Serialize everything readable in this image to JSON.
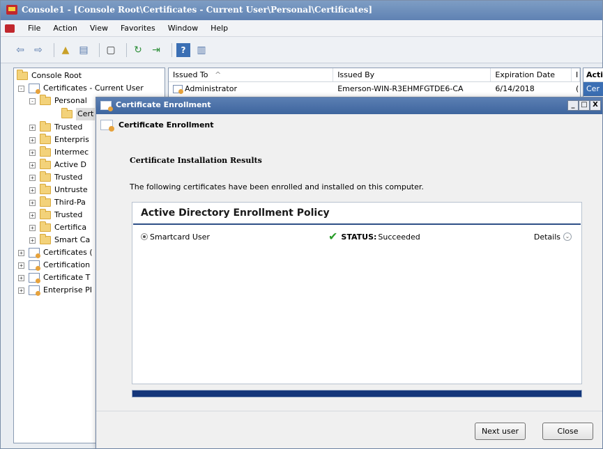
{
  "window": {
    "title": "Console1 - [Console Root\\Certificates - Current User\\Personal\\Certificates]"
  },
  "menubar": [
    "File",
    "Action",
    "View",
    "Favorites",
    "Window",
    "Help"
  ],
  "toolbar": {
    "icons": [
      "back-arrow-icon",
      "forward-arrow-icon",
      "up-folder-icon",
      "show-hide-tree-icon",
      "properties-icon",
      "refresh-icon",
      "export-list-icon",
      "help-icon",
      "show-hide-action-pane-icon"
    ]
  },
  "tree": {
    "items": [
      {
        "label": "Console Root",
        "icon": "folder-icon",
        "expander": ""
      },
      {
        "label": "Certificates - Current User",
        "icon": "certificate-store-icon",
        "expander": "-"
      },
      {
        "label": "Personal",
        "icon": "folder-icon",
        "expander": "-"
      },
      {
        "label": "Cert",
        "icon": "folder-icon",
        "expander": ""
      },
      {
        "label": "Trusted",
        "icon": "folder-icon",
        "expander": "+"
      },
      {
        "label": "Enterpris",
        "icon": "folder-icon",
        "expander": "+"
      },
      {
        "label": "Intermec",
        "icon": "folder-icon",
        "expander": "+"
      },
      {
        "label": "Active D",
        "icon": "folder-icon",
        "expander": "+"
      },
      {
        "label": "Trusted",
        "icon": "folder-icon",
        "expander": "+"
      },
      {
        "label": "Untruste",
        "icon": "folder-icon",
        "expander": "+"
      },
      {
        "label": "Third-Pa",
        "icon": "folder-icon",
        "expander": "+"
      },
      {
        "label": "Trusted",
        "icon": "folder-icon",
        "expander": "+"
      },
      {
        "label": "Certifica",
        "icon": "folder-icon",
        "expander": "+"
      },
      {
        "label": "Smart Ca",
        "icon": "folder-icon",
        "expander": "+"
      },
      {
        "label": "Certificates (",
        "icon": "certificate-store-icon",
        "expander": "+"
      },
      {
        "label": "Certification",
        "icon": "certificate-store-icon",
        "expander": "+"
      },
      {
        "label": "Certificate T",
        "icon": "certificate-store-icon",
        "expander": "+"
      },
      {
        "label": "Enterprise PI",
        "icon": "certificate-store-icon",
        "expander": "+"
      }
    ]
  },
  "list": {
    "columns": [
      "Issued To",
      "Issued By",
      "Expiration Date",
      "I"
    ],
    "sort_indicator": "^",
    "rows": [
      {
        "issued_to": "Administrator",
        "issued_by": "Emerson-WIN-R3EHMFGTDE6-CA",
        "expiration": "6/14/2018",
        "extra": "("
      }
    ]
  },
  "actions_pane": {
    "header": "Acti",
    "sub": "Cer"
  },
  "dialog": {
    "title": "Certificate Enrollment",
    "header": "Certificate Enrollment",
    "section_title": "Certificate Installation Results",
    "description": "The following certificates have been enrolled and installed on this computer.",
    "policy": {
      "name": "Active Directory Enrollment Policy",
      "certificates": [
        {
          "name": "Smartcard User",
          "status_label": "STATUS:",
          "status_value": "Succeeded",
          "details_label": "Details"
        }
      ]
    },
    "progress": 1.0,
    "buttons": {
      "next_user": "Next user",
      "close": "Close"
    },
    "window_controls": {
      "minimize": "_",
      "maximize": "□",
      "close": "X"
    }
  },
  "colors": {
    "title_bar": "#5f82b3",
    "progress": "#14367a",
    "success": "#2a9d2a",
    "policy_rule": "#2d4f86"
  }
}
